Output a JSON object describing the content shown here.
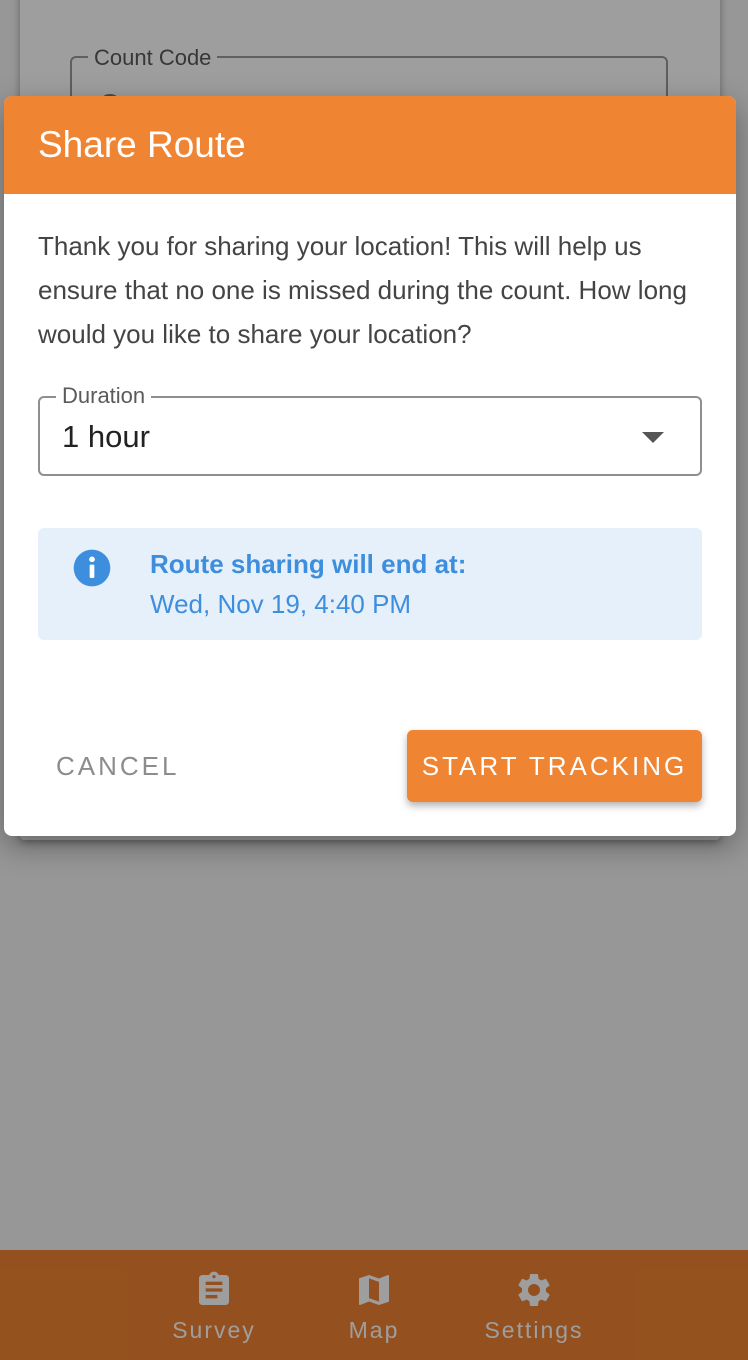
{
  "background": {
    "count_code_label": "Count Code"
  },
  "dialog": {
    "title": "Share Route",
    "message": "Thank you for sharing your location! This will help us ensure that no one is missed during the count. How long would you like to share your location?",
    "duration": {
      "label": "Duration",
      "selected": "1 hour"
    },
    "info": {
      "title": "Route sharing will end at:",
      "detail": "Wed, Nov 19, 4:40 PM"
    },
    "actions": {
      "cancel": "CANCEL",
      "start": "START TRACKING"
    }
  },
  "bottom_nav": {
    "items": [
      {
        "label": "Survey",
        "icon": "clipboard-icon"
      },
      {
        "label": "Map",
        "icon": "map-icon"
      },
      {
        "label": "Settings",
        "icon": "gear-icon"
      }
    ]
  },
  "colors": {
    "accent": "#ef8432",
    "info_text": "#3e8ede",
    "info_background": "#e6f0fb"
  }
}
